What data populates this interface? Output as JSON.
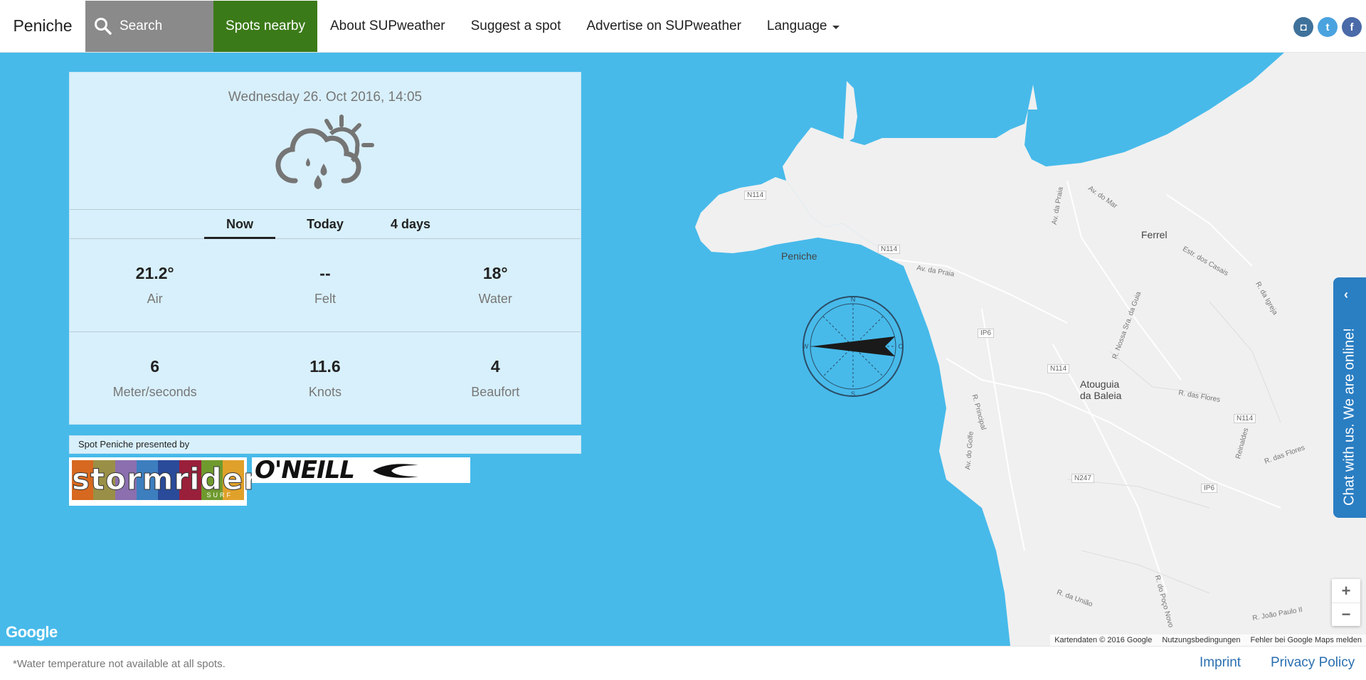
{
  "nav": {
    "brand": "Peniche",
    "search_label": "Search",
    "items": [
      "Spots nearby",
      "About SUPweather",
      "Suggest a spot",
      "Advertise on SUPweather"
    ],
    "language_label": "Language",
    "social": [
      {
        "name": "instagram",
        "glyph": "◘"
      },
      {
        "name": "twitter",
        "glyph": "t"
      },
      {
        "name": "facebook",
        "glyph": "f"
      }
    ]
  },
  "weather": {
    "date": "Wednesday 26. Oct 2016, 14:05",
    "icon": "cloud-sun-rain-icon",
    "tabs": [
      "Now",
      "Today",
      "4 days"
    ],
    "active_tab": "Now",
    "temps": [
      {
        "value": "21.2°",
        "label": "Air"
      },
      {
        "value": "--",
        "label": "Felt"
      },
      {
        "value": "18°",
        "label": "Water"
      }
    ],
    "wind": [
      {
        "value": "6",
        "label": "Meter/seconds"
      },
      {
        "value": "11.6",
        "label": "Knots"
      },
      {
        "value": "4",
        "label": "Beaufort"
      }
    ]
  },
  "sponsors": {
    "presented_by": "Spot Peniche presented by",
    "stormrider": "stormrider",
    "stormrider_sub": "SURF",
    "oneill": "O'NEILL"
  },
  "map": {
    "places": [
      "Peniche",
      "Ferrel",
      "Atouguia",
      "da Baleia"
    ],
    "roads": [
      "N114",
      "N114",
      "N114",
      "N114",
      "IP6",
      "IP6",
      "N247"
    ],
    "streets": [
      "Av. da Praia",
      "Av. do Mar",
      "Av. da Praia",
      "Estr. dos Casais",
      "R. da Igreja",
      "R. Nossa Sra. da Guia",
      "R. Principal",
      "Av. do Golfe",
      "R. das Flores",
      "R. das Flores",
      "Reinaldes",
      "R. da União",
      "R. do Poço Novo",
      "R. João Paulo II"
    ],
    "compass": [
      "N",
      "S",
      "W",
      "O"
    ],
    "logo": "Google",
    "attribution": [
      "Kartendaten © 2016 Google",
      "Nutzungsbedingungen",
      "Fehler bei Google Maps melden"
    ],
    "zoom_in": "+",
    "zoom_out": "−",
    "wind_direction": "W"
  },
  "chat": {
    "chevron": "‹",
    "label": "Chat with us. We are online!"
  },
  "footer": {
    "note": "*Water temperature not available at all spots.",
    "imprint": "Imprint",
    "privacy": "Privacy Policy"
  }
}
